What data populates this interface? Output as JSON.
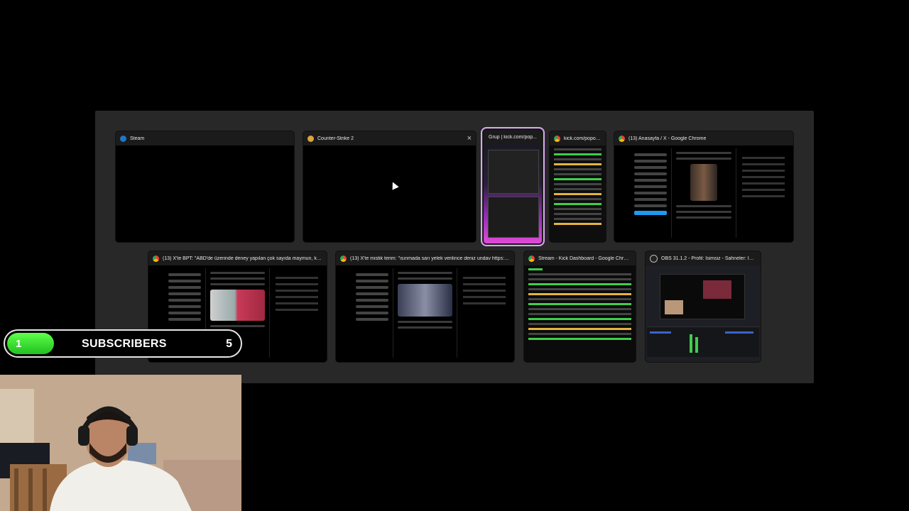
{
  "switcher": {
    "windows": [
      {
        "title": "Steam",
        "icon": "steam-icon"
      },
      {
        "title": "Counter-Strike 2",
        "icon": "counter-strike-icon",
        "close": "×"
      },
      {
        "title": "Grup | kick.com/pop...",
        "icon": "chrome-icon",
        "selected": true
      },
      {
        "title": "kick.com/popout/k...",
        "icon": "chrome-icon"
      },
      {
        "title": "(13) Anasayfa / X - Google Chrome",
        "icon": "chrome-icon"
      },
      {
        "title": "(13) X'te BPT: \"ABD'de üzerinde deney yapılan çok sayıda maymun, kendilerini taşıya...",
        "icon": "chrome-icon"
      },
      {
        "title": "(13) X'te mistik terim: \"ısınmada sarı yelek verilince deniz undav https://t.co/CImybXX...",
        "icon": "chrome-icon"
      },
      {
        "title": "Stream - Kick Dashboard - Google Chrome",
        "icon": "chrome-icon"
      },
      {
        "title": "OBS 31.1.2 - Profil: İsimsiz - Sahneler: İsimsiz",
        "icon": "obs-icon"
      }
    ]
  },
  "subscriber_widget": {
    "current": "1",
    "label": "SUBSCRIBERS",
    "goal": "5",
    "progress_fraction": 0.2
  }
}
